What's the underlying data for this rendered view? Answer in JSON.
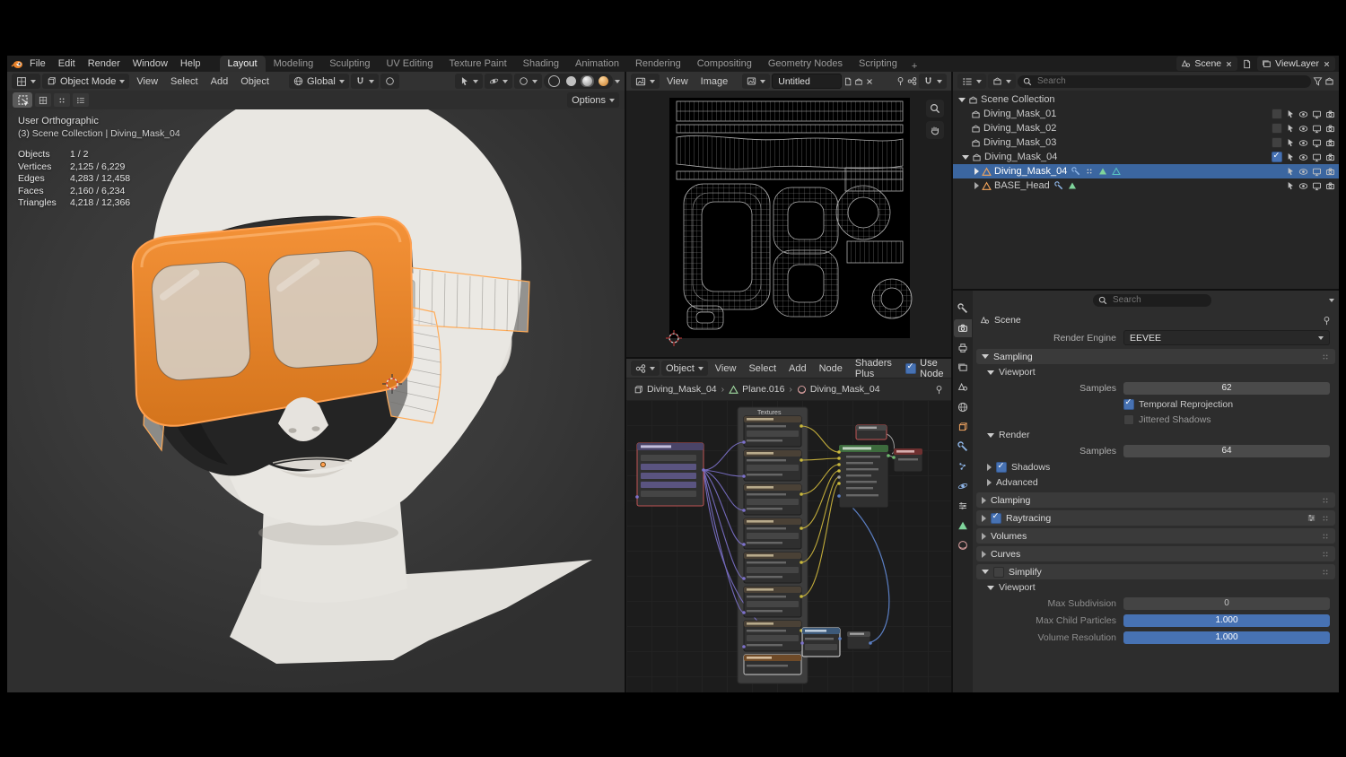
{
  "topbar": {
    "menus": [
      "File",
      "Edit",
      "Render",
      "Window",
      "Help"
    ],
    "tabs": [
      "Layout",
      "Modeling",
      "Sculpting",
      "UV Editing",
      "Texture Paint",
      "Shading",
      "Animation",
      "Rendering",
      "Compositing",
      "Geometry Nodes",
      "Scripting"
    ],
    "active_tab": "Layout",
    "add_workspace_label": "+",
    "scene_name": "Scene",
    "view_layer_name": "ViewLayer"
  },
  "viewport": {
    "mode": "Object Mode",
    "menus": [
      "View",
      "Select",
      "Add",
      "Object"
    ],
    "orientation": "Global",
    "options_label": "Options",
    "view_name": "User Orthographic",
    "context_path": "(3) Scene Collection | Diving_Mask_04",
    "stats": [
      {
        "label": "Objects",
        "value": "1 / 2"
      },
      {
        "label": "Vertices",
        "value": "2,125 / 6,229"
      },
      {
        "label": "Edges",
        "value": "4,283 / 12,458"
      },
      {
        "label": "Faces",
        "value": "2,160 / 6,234"
      },
      {
        "label": "Triangles",
        "value": "4,218 / 12,366"
      }
    ]
  },
  "uv_editor": {
    "menus": [
      "View",
      "Image"
    ],
    "image_name": "Untitled"
  },
  "shader_editor": {
    "shader_type": "Object",
    "menus": [
      "View",
      "Select",
      "Add",
      "Node",
      "Shaders Plus"
    ],
    "use_nodes_label": "Use Node",
    "breadcrumb": [
      "Diving_Mask_04",
      "Plane.016",
      "Diving_Mask_04"
    ],
    "frame_label": "Textures"
  },
  "outliner": {
    "search_placeholder": "Search",
    "rows": [
      {
        "name": "Scene Collection"
      },
      {
        "name": "Diving_Mask_01"
      },
      {
        "name": "Diving_Mask_02"
      },
      {
        "name": "Diving_Mask_03"
      },
      {
        "name": "Diving_Mask_04"
      },
      {
        "name": "Diving_Mask_04"
      },
      {
        "name": "BASE_Head"
      }
    ]
  },
  "properties": {
    "search_placeholder": "Search",
    "context_name": "Scene",
    "render_engine_label": "Render Engine",
    "render_engine": "EEVEE",
    "sampling_label": "Sampling",
    "viewport_label": "Viewport",
    "samples_label": "Samples",
    "viewport_samples": "62",
    "temporal_reprojection_label": "Temporal Reprojection",
    "jittered_shadows_label": "Jittered Shadows",
    "render_label": "Render",
    "render_samples": "64",
    "shadows_label": "Shadows",
    "advanced_label": "Advanced",
    "clamping_label": "Clamping",
    "raytracing_label": "Raytracing",
    "volumes_label": "Volumes",
    "curves_label": "Curves",
    "simplify_label": "Simplify",
    "simplify_viewport_label": "Viewport",
    "max_subdivision_label": "Max Subdivision",
    "max_subdivision_value": "0",
    "max_child_particles_label": "Max Child Particles",
    "max_child_particles_value": "1.000",
    "volume_resolution_label": "Volume Resolution",
    "volume_resolution_value": "1.000"
  },
  "colors": {
    "accent_blue": "#4772b3",
    "object_orange": "#e8822a"
  }
}
